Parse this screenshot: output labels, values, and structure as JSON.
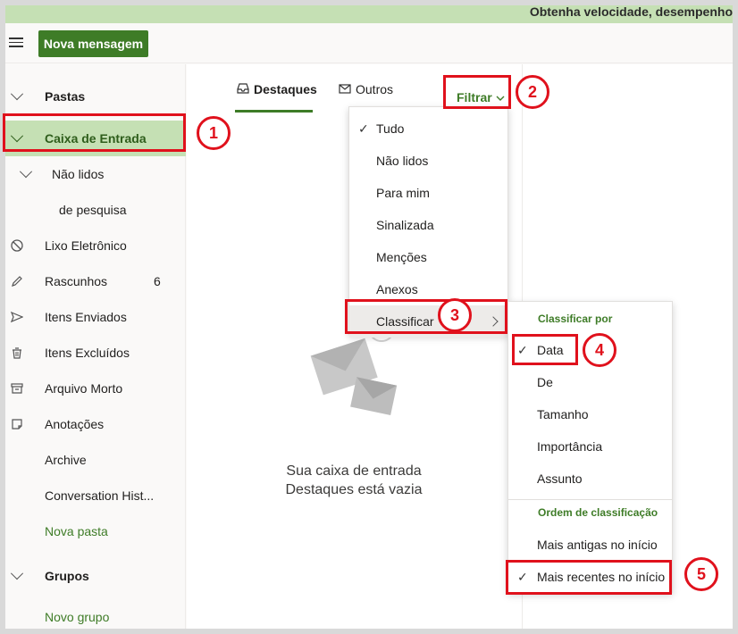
{
  "banner": {
    "text": "Obtenha velocidade, desempenho"
  },
  "toolbar": {
    "new_message": "Nova mensagem"
  },
  "sidebar": {
    "folders_header": "Pastas",
    "inbox": "Caixa de Entrada",
    "unread": "Não lidos",
    "search": "de pesquisa",
    "junk": "Lixo Eletrônico",
    "drafts": "Rascunhos",
    "drafts_count": "6",
    "sent": "Itens Enviados",
    "deleted": "Itens Excluídos",
    "archive_pt": "Arquivo Morto",
    "notes": "Anotações",
    "archive": "Archive",
    "conversation": "Conversation Hist...",
    "new_folder": "Nova pasta",
    "groups_header": "Grupos",
    "new_group": "Novo grupo"
  },
  "tabs": {
    "focused": "Destaques",
    "other": "Outros"
  },
  "filter": {
    "label": "Filtrar"
  },
  "filter_menu": {
    "items": [
      "Tudo",
      "Não lidos",
      "Para mim",
      "Sinalizada",
      "Menções",
      "Anexos"
    ],
    "sort": "Classificar"
  },
  "sort_menu": {
    "sort_by_header": "Classificar por",
    "sort_by": [
      "Data",
      "De",
      "Tamanho",
      "Importância",
      "Assunto"
    ],
    "order_header": "Ordem de classificação",
    "order": [
      "Mais antigas no início",
      "Mais recentes no início"
    ]
  },
  "empty": {
    "line1": "Sua caixa de entrada",
    "line2": "Destaques está vazia"
  },
  "annotations": {
    "n1": "1",
    "n2": "2",
    "n3": "3",
    "n4": "4",
    "n5": "5"
  },
  "colors": {
    "accent": "#3e7c27",
    "inbox_bg": "#c5e0b4",
    "annotation": "#e0111c"
  }
}
